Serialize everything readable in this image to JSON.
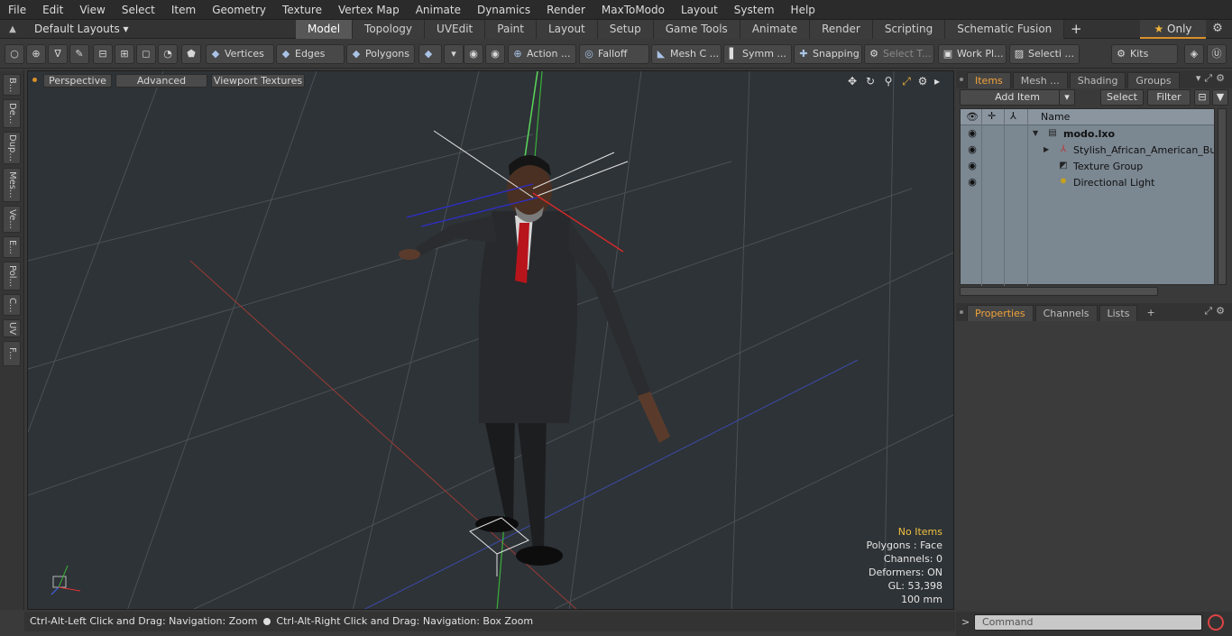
{
  "menu": [
    "File",
    "Edit",
    "View",
    "Select",
    "Item",
    "Geometry",
    "Texture",
    "Vertex Map",
    "Animate",
    "Dynamics",
    "Render",
    "MaxToModo",
    "Layout",
    "System",
    "Help"
  ],
  "layouts": {
    "dropdown_label": "Default Layouts",
    "tabs": [
      "Model",
      "Topology",
      "UVEdit",
      "Paint",
      "Layout",
      "Setup",
      "Game Tools",
      "Animate",
      "Render",
      "Scripting",
      "Schematic Fusion"
    ],
    "active_tab": "Model",
    "add_tab": "+",
    "only_label": "Only"
  },
  "toolbar": {
    "vertices": "Vertices",
    "edges": "Edges",
    "polygons": "Polygons",
    "action": "Action ...",
    "falloff": "Falloff",
    "mesh": "Mesh C ...",
    "symmetry": "Symm ...",
    "snapping": "Snapping",
    "select_t": "Select T...",
    "work_plane": "Work Pl...",
    "selection": "Selecti ...",
    "kits": "Kits"
  },
  "left_tabs": [
    "B...",
    "De...",
    "Dup...",
    "Mes...",
    "Ve...",
    "E...",
    "Pol...",
    "C...",
    "UV",
    "F..."
  ],
  "viewport": {
    "perspective": "Perspective",
    "advanced": "Advanced",
    "textures": "Viewport Textures",
    "info": {
      "selection": "No Items",
      "polygons": "Polygons : Face",
      "channels": "Channels: 0",
      "deformers": "Deformers: ON",
      "gl": "GL: 53,398",
      "scale": "100 mm"
    }
  },
  "status": {
    "left": "Ctrl-Alt-Left Click and Drag: Navigation: Zoom",
    "right": "Ctrl-Alt-Right Click and Drag: Navigation: Box Zoom"
  },
  "items_panel": {
    "tabs": [
      "Items",
      "Mesh ...",
      "Shading",
      "Groups"
    ],
    "active_tab": "Items",
    "add_item": "Add Item",
    "select": "Select",
    "filter": "Filter",
    "name_header": "Name",
    "rows": [
      {
        "label": "modo.lxo",
        "bold": true
      },
      {
        "label": "Stylish_African_American_Bu ..."
      },
      {
        "label": "Texture Group"
      },
      {
        "label": "Directional Light"
      }
    ]
  },
  "props_panel": {
    "tabs": [
      "Properties",
      "Channels",
      "Lists"
    ],
    "active_tab": "Properties",
    "add": "+"
  },
  "command": {
    "placeholder": "Command"
  },
  "colors": {
    "accent": "#f0a23a",
    "viewport_bg": "#2e3337",
    "item_list_bg": "#7b8791",
    "info_highlight": "#f0c040"
  }
}
